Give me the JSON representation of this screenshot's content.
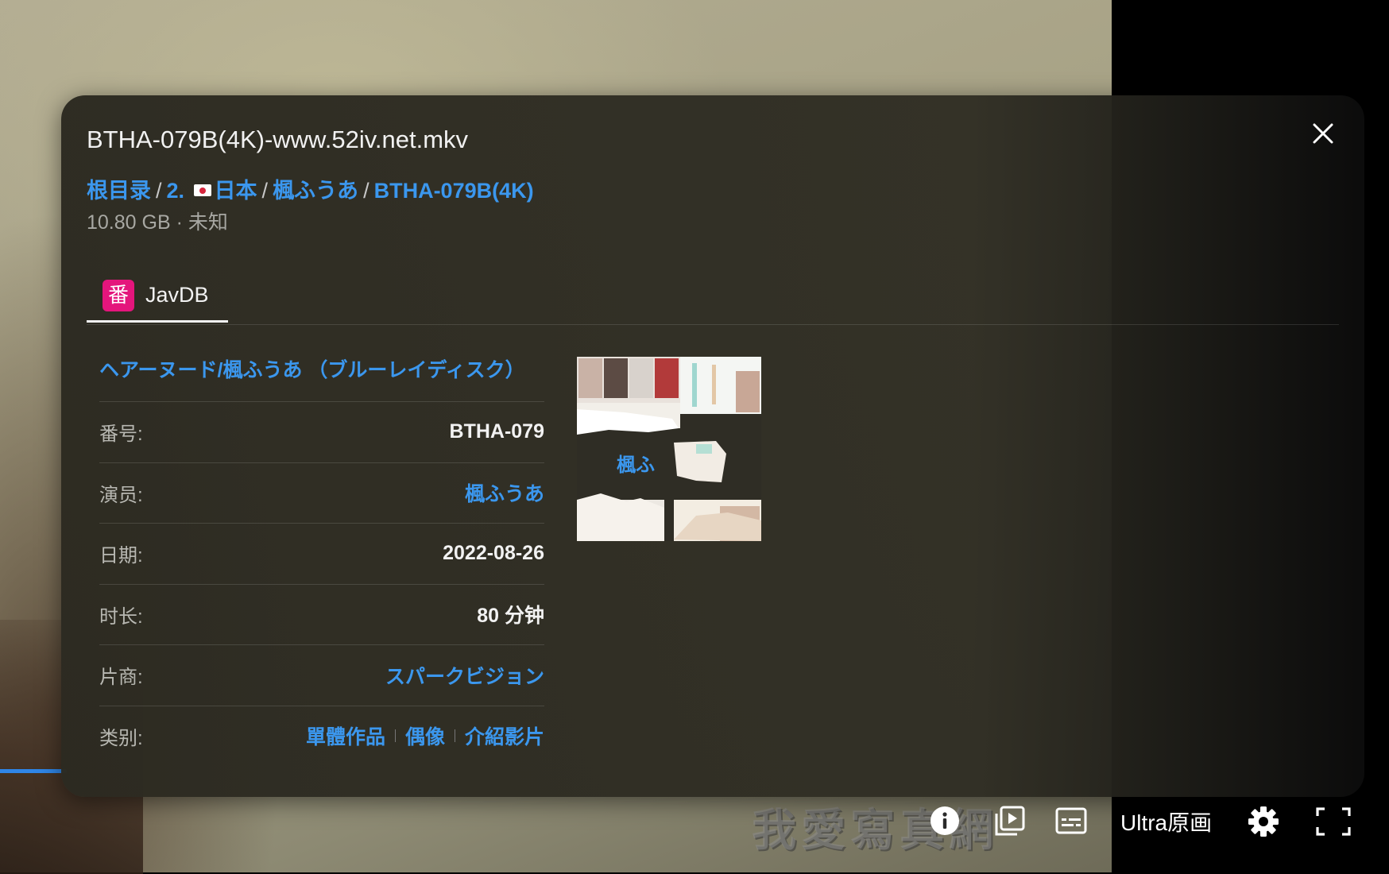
{
  "file": {
    "title": "BTHA-079B(4K)-www.52iv.net.mkv",
    "breadcrumb": [
      "根目录",
      "2. ",
      "日本",
      "楓ふうあ",
      "BTHA-079B(4K)"
    ],
    "meta": "10.80 GB · 未知"
  },
  "tabs": [
    {
      "label": "JavDB",
      "badge": "番",
      "active": true
    }
  ],
  "movie": {
    "title": "ヘアーヌード/楓ふうあ （ブルーレイディスク）",
    "fields": {
      "code": {
        "label": "番号:",
        "value": "BTHA-079"
      },
      "actor": {
        "label": "演员:",
        "value": "楓ふうあ"
      },
      "date": {
        "label": "日期:",
        "value": "2022-08-26"
      },
      "duration": {
        "label": "时长:",
        "value": "80 分钟"
      },
      "studio": {
        "label": "片商:",
        "value": "スパークビジョン"
      },
      "genre": {
        "label": "类别:",
        "values": [
          "單體作品",
          "偶像",
          "介紹影片"
        ]
      }
    },
    "cover_text": "楓ふ"
  },
  "player": {
    "watermark": "我愛寫真網",
    "quality": "Ultra原画",
    "progress_played_fraction": 0.06
  },
  "colors": {
    "accent": "#3b97ee",
    "badge": "#e4157c"
  },
  "icons": [
    "close-icon",
    "info-icon",
    "playlist-icon",
    "subtitles-icon",
    "settings-icon",
    "fullscreen-icon"
  ]
}
